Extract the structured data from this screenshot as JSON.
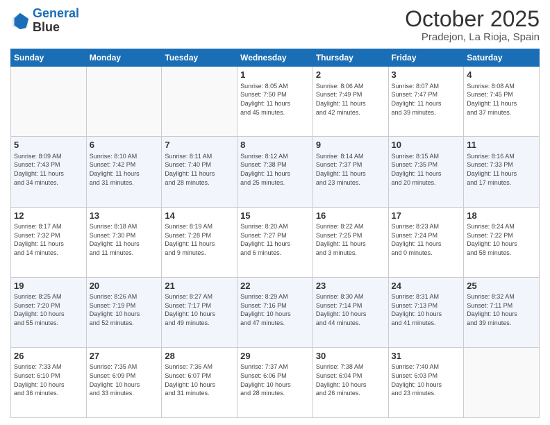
{
  "header": {
    "logo_line1": "General",
    "logo_line2": "Blue",
    "month": "October 2025",
    "location": "Pradejon, La Rioja, Spain"
  },
  "weekdays": [
    "Sunday",
    "Monday",
    "Tuesday",
    "Wednesday",
    "Thursday",
    "Friday",
    "Saturday"
  ],
  "weeks": [
    [
      {
        "day": "",
        "info": ""
      },
      {
        "day": "",
        "info": ""
      },
      {
        "day": "",
        "info": ""
      },
      {
        "day": "1",
        "info": "Sunrise: 8:05 AM\nSunset: 7:50 PM\nDaylight: 11 hours\nand 45 minutes."
      },
      {
        "day": "2",
        "info": "Sunrise: 8:06 AM\nSunset: 7:49 PM\nDaylight: 11 hours\nand 42 minutes."
      },
      {
        "day": "3",
        "info": "Sunrise: 8:07 AM\nSunset: 7:47 PM\nDaylight: 11 hours\nand 39 minutes."
      },
      {
        "day": "4",
        "info": "Sunrise: 8:08 AM\nSunset: 7:45 PM\nDaylight: 11 hours\nand 37 minutes."
      }
    ],
    [
      {
        "day": "5",
        "info": "Sunrise: 8:09 AM\nSunset: 7:43 PM\nDaylight: 11 hours\nand 34 minutes."
      },
      {
        "day": "6",
        "info": "Sunrise: 8:10 AM\nSunset: 7:42 PM\nDaylight: 11 hours\nand 31 minutes."
      },
      {
        "day": "7",
        "info": "Sunrise: 8:11 AM\nSunset: 7:40 PM\nDaylight: 11 hours\nand 28 minutes."
      },
      {
        "day": "8",
        "info": "Sunrise: 8:12 AM\nSunset: 7:38 PM\nDaylight: 11 hours\nand 25 minutes."
      },
      {
        "day": "9",
        "info": "Sunrise: 8:14 AM\nSunset: 7:37 PM\nDaylight: 11 hours\nand 23 minutes."
      },
      {
        "day": "10",
        "info": "Sunrise: 8:15 AM\nSunset: 7:35 PM\nDaylight: 11 hours\nand 20 minutes."
      },
      {
        "day": "11",
        "info": "Sunrise: 8:16 AM\nSunset: 7:33 PM\nDaylight: 11 hours\nand 17 minutes."
      }
    ],
    [
      {
        "day": "12",
        "info": "Sunrise: 8:17 AM\nSunset: 7:32 PM\nDaylight: 11 hours\nand 14 minutes."
      },
      {
        "day": "13",
        "info": "Sunrise: 8:18 AM\nSunset: 7:30 PM\nDaylight: 11 hours\nand 11 minutes."
      },
      {
        "day": "14",
        "info": "Sunrise: 8:19 AM\nSunset: 7:28 PM\nDaylight: 11 hours\nand 9 minutes."
      },
      {
        "day": "15",
        "info": "Sunrise: 8:20 AM\nSunset: 7:27 PM\nDaylight: 11 hours\nand 6 minutes."
      },
      {
        "day": "16",
        "info": "Sunrise: 8:22 AM\nSunset: 7:25 PM\nDaylight: 11 hours\nand 3 minutes."
      },
      {
        "day": "17",
        "info": "Sunrise: 8:23 AM\nSunset: 7:24 PM\nDaylight: 11 hours\nand 0 minutes."
      },
      {
        "day": "18",
        "info": "Sunrise: 8:24 AM\nSunset: 7:22 PM\nDaylight: 10 hours\nand 58 minutes."
      }
    ],
    [
      {
        "day": "19",
        "info": "Sunrise: 8:25 AM\nSunset: 7:20 PM\nDaylight: 10 hours\nand 55 minutes."
      },
      {
        "day": "20",
        "info": "Sunrise: 8:26 AM\nSunset: 7:19 PM\nDaylight: 10 hours\nand 52 minutes."
      },
      {
        "day": "21",
        "info": "Sunrise: 8:27 AM\nSunset: 7:17 PM\nDaylight: 10 hours\nand 49 minutes."
      },
      {
        "day": "22",
        "info": "Sunrise: 8:29 AM\nSunset: 7:16 PM\nDaylight: 10 hours\nand 47 minutes."
      },
      {
        "day": "23",
        "info": "Sunrise: 8:30 AM\nSunset: 7:14 PM\nDaylight: 10 hours\nand 44 minutes."
      },
      {
        "day": "24",
        "info": "Sunrise: 8:31 AM\nSunset: 7:13 PM\nDaylight: 10 hours\nand 41 minutes."
      },
      {
        "day": "25",
        "info": "Sunrise: 8:32 AM\nSunset: 7:11 PM\nDaylight: 10 hours\nand 39 minutes."
      }
    ],
    [
      {
        "day": "26",
        "info": "Sunrise: 7:33 AM\nSunset: 6:10 PM\nDaylight: 10 hours\nand 36 minutes."
      },
      {
        "day": "27",
        "info": "Sunrise: 7:35 AM\nSunset: 6:09 PM\nDaylight: 10 hours\nand 33 minutes."
      },
      {
        "day": "28",
        "info": "Sunrise: 7:36 AM\nSunset: 6:07 PM\nDaylight: 10 hours\nand 31 minutes."
      },
      {
        "day": "29",
        "info": "Sunrise: 7:37 AM\nSunset: 6:06 PM\nDaylight: 10 hours\nand 28 minutes."
      },
      {
        "day": "30",
        "info": "Sunrise: 7:38 AM\nSunset: 6:04 PM\nDaylight: 10 hours\nand 26 minutes."
      },
      {
        "day": "31",
        "info": "Sunrise: 7:40 AM\nSunset: 6:03 PM\nDaylight: 10 hours\nand 23 minutes."
      },
      {
        "day": "",
        "info": ""
      }
    ]
  ]
}
